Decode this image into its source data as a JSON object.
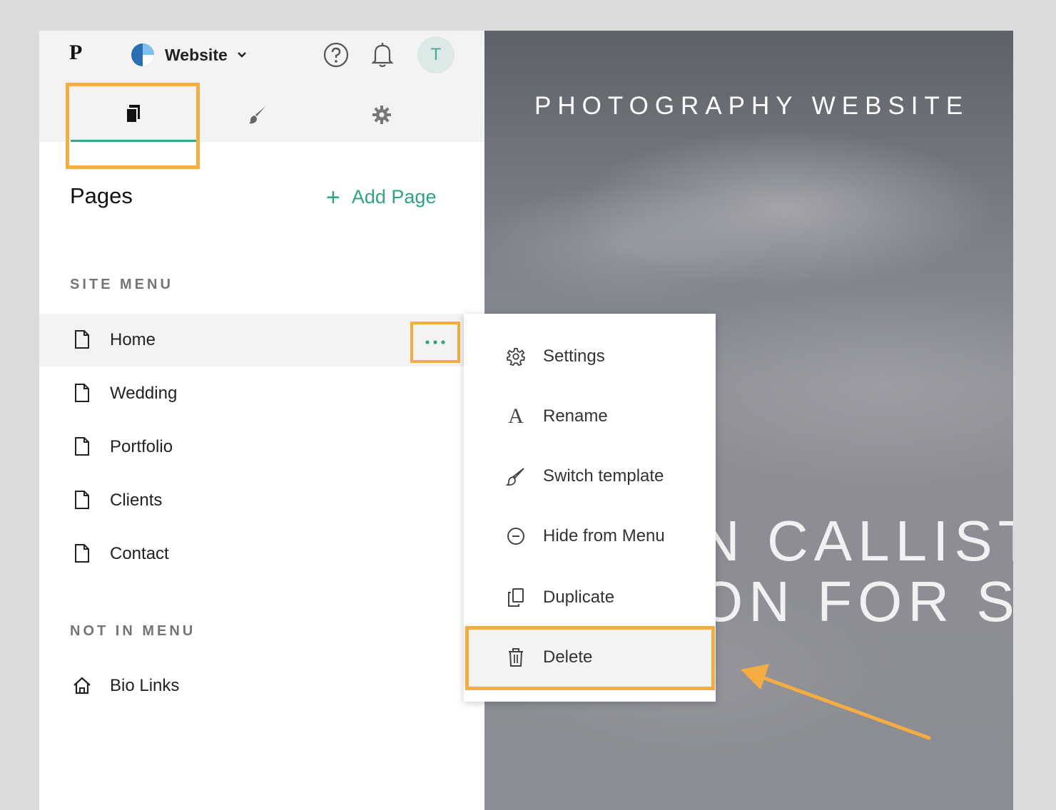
{
  "topbar": {
    "logo": "P",
    "site_name": "Website",
    "avatar_initial": "T"
  },
  "tabs": [
    {
      "name": "pages-icon",
      "active": true
    },
    {
      "name": "brush-icon",
      "active": false
    },
    {
      "name": "gear-icon",
      "active": false
    }
  ],
  "pages_panel": {
    "title": "Pages",
    "add_page": "Add Page",
    "site_menu_label": "SITE MENU",
    "site_menu": [
      {
        "label": "Home",
        "icon": "page-icon",
        "selected": true
      },
      {
        "label": "Wedding",
        "icon": "page-icon"
      },
      {
        "label": "Portfolio",
        "icon": "page-icon"
      },
      {
        "label": "Clients",
        "icon": "page-icon"
      },
      {
        "label": "Contact",
        "icon": "page-icon"
      }
    ],
    "not_in_menu_label": "NOT IN MENU",
    "not_in_menu": [
      {
        "label": "Bio Links",
        "icon": "home-icon"
      }
    ]
  },
  "context_menu": [
    {
      "label": "Settings",
      "icon": "gear-icon"
    },
    {
      "label": "Rename",
      "icon": "letter-a-icon"
    },
    {
      "label": "Switch template",
      "icon": "brush-icon"
    },
    {
      "label": "Hide from Menu",
      "icon": "minus-circle-icon"
    },
    {
      "label": "Duplicate",
      "icon": "duplicate-icon"
    },
    {
      "label": "Delete",
      "icon": "trash-icon"
    }
  ],
  "preview": {
    "site_title": "PHOTOGRAPHY WEBSITE",
    "hero_line1": "N CALLIST",
    "hero_line2": "ON FOR S"
  },
  "colors": {
    "accent": "#2fa383",
    "highlight": "#f5ad42"
  }
}
